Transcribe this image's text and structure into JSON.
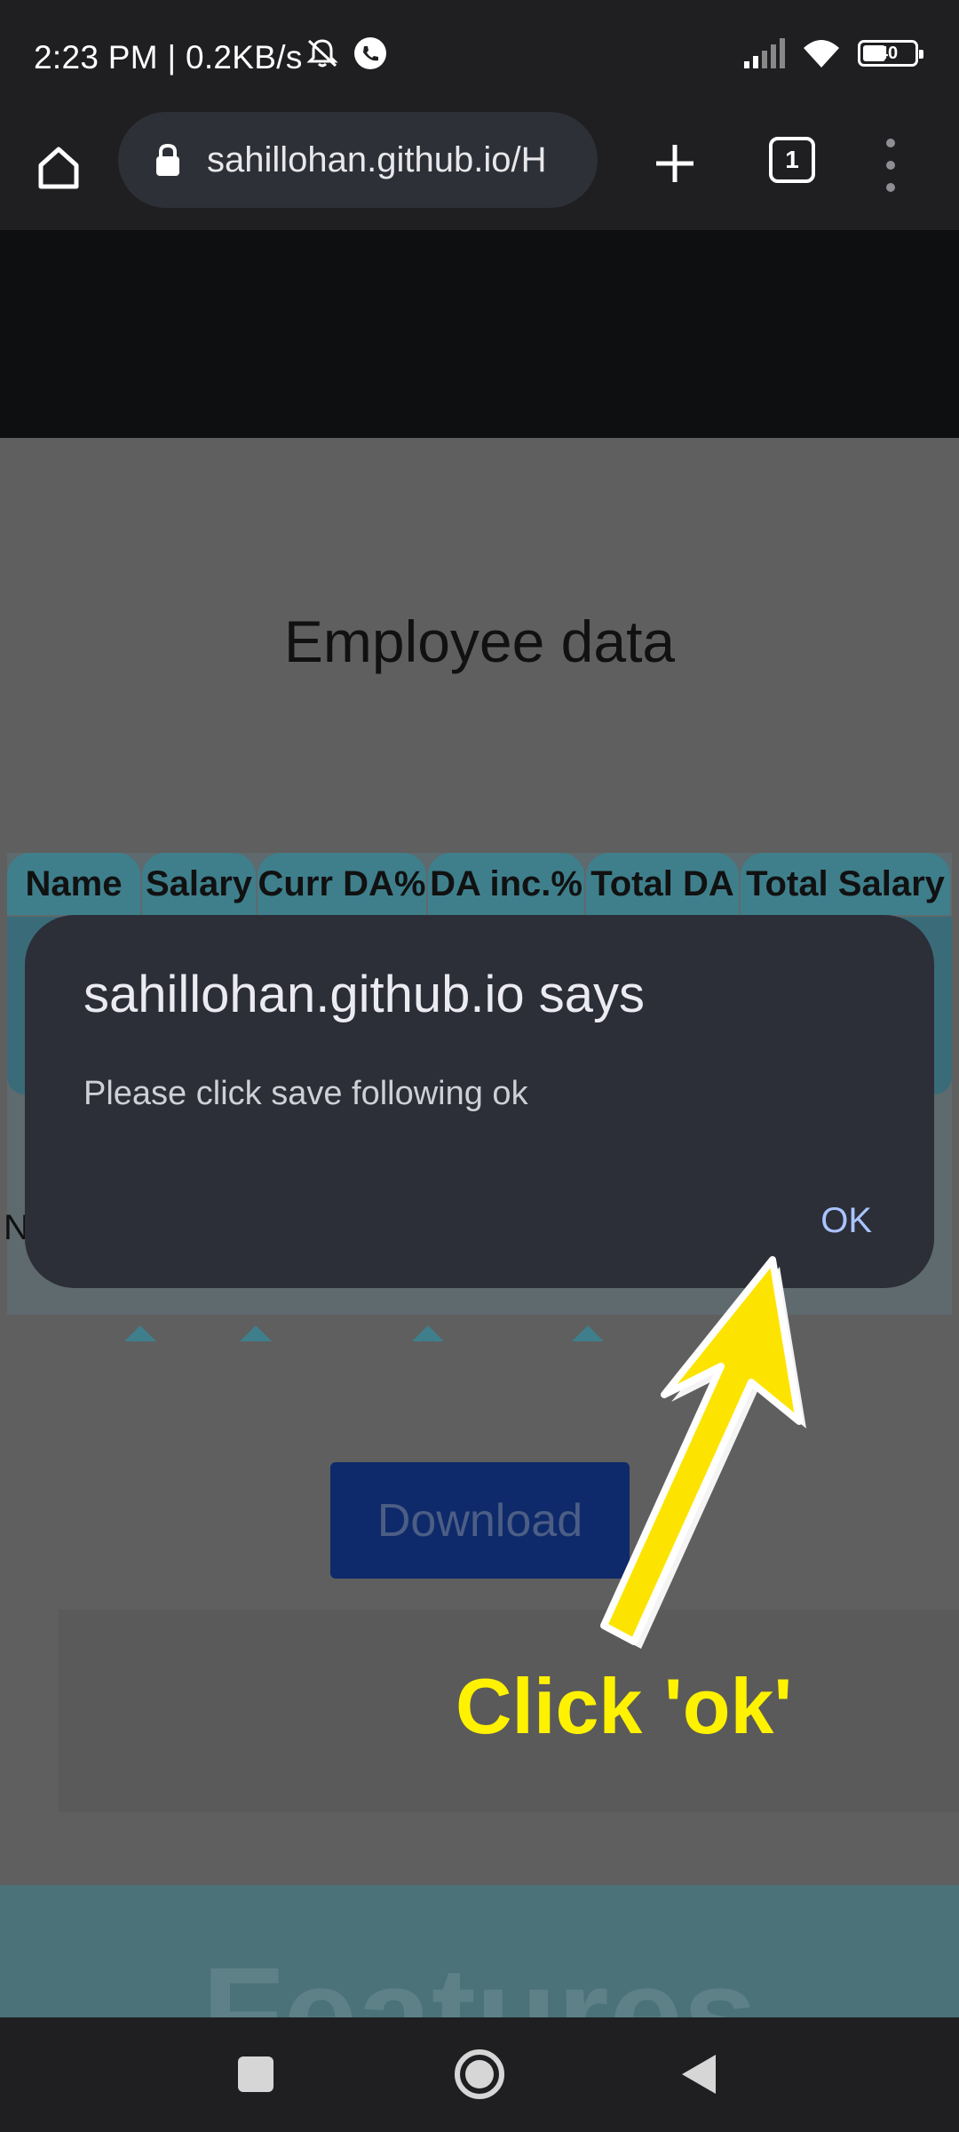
{
  "status_bar": {
    "time": "2:23 PM | 0.2KB/s",
    "battery": "40"
  },
  "browser": {
    "url": "sahillohan.github.io/H",
    "tab_count": "1"
  },
  "page": {
    "title": "Employee data",
    "table_headers": [
      "Name",
      "Salary",
      "Curr DA%",
      "DA inc.%",
      "Total DA",
      "Total Salary"
    ],
    "partial_row_letter": "N",
    "download_label": "Download",
    "features_heading": "Features"
  },
  "dialog": {
    "title": "sahillohan.github.io says",
    "message": "Please click save following ok",
    "ok_label": "OK"
  },
  "annotation": {
    "text": "Click 'ok'"
  },
  "colors": {
    "accent_yellow": "#fff200",
    "dialog_bg": "#2c2e38",
    "ok_blue": "#a9c4ff"
  }
}
